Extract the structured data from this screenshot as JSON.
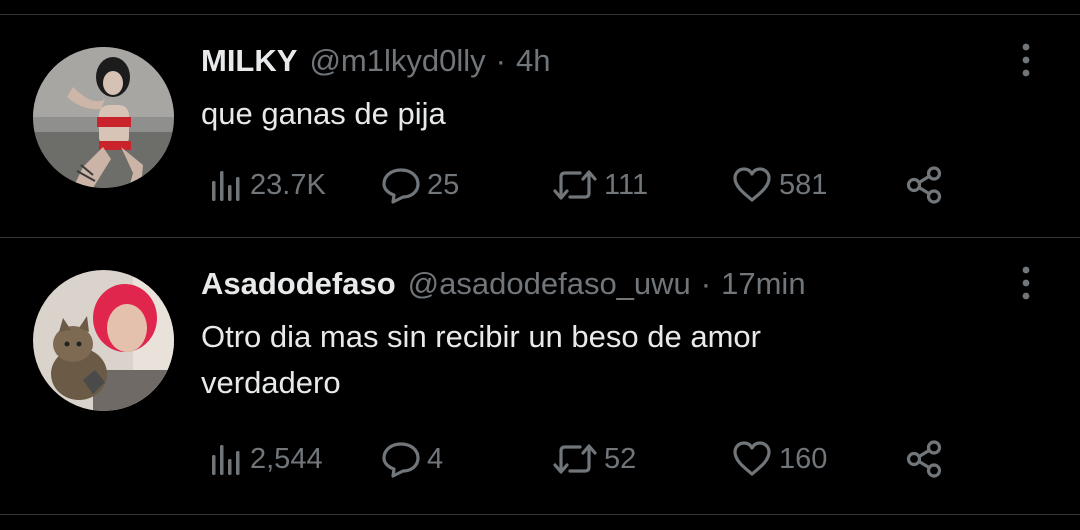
{
  "tweets": [
    {
      "author_name": "MILKY",
      "handle": "@m1lkyd0lly",
      "separator": "·",
      "time": "4h",
      "text": "que ganas de pija",
      "views": "23.7K",
      "replies": "25",
      "retweets": "111",
      "likes": "581"
    },
    {
      "author_name": "Asadodefaso",
      "handle": "@asadodefaso_uwu",
      "separator": "·",
      "time": "17min",
      "text": "Otro dia mas sin recibir un beso de amor verdadero",
      "views": "2,544",
      "replies": "4",
      "retweets": "52",
      "likes": "160"
    }
  ],
  "icons": {
    "views": "views-bar-chart-icon",
    "reply": "reply-speech-bubble-icon",
    "retweet": "retweet-arrows-icon",
    "like": "heart-icon",
    "share": "share-nodes-icon",
    "more": "more-vertical-dots-icon"
  },
  "colors": {
    "background": "#000000",
    "primary_text": "#e7e9ea",
    "secondary_text": "#71767b",
    "divider": "#2f3336"
  }
}
